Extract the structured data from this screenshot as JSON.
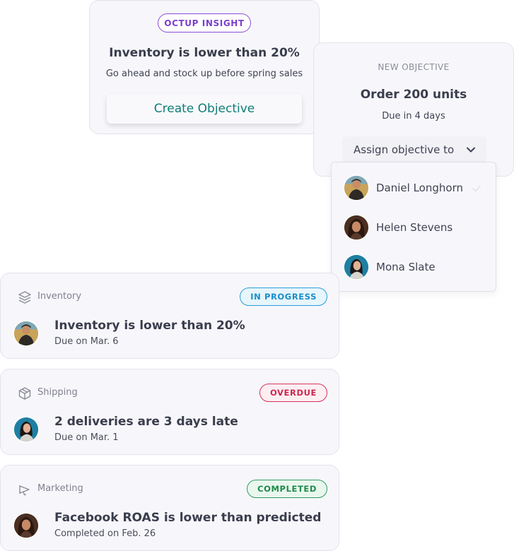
{
  "insight": {
    "badge": "OCTUP INSIGHT",
    "title": "Inventory is lower than 20%",
    "subtitle": "Go ahead and stock up before spring sales",
    "button": "Create Objective"
  },
  "objective": {
    "label": "NEW OBJECTIVE",
    "title": "Order 200 units",
    "due": "Due in 4 days",
    "assign_label": "Assign objective to"
  },
  "assignees": [
    {
      "name": "Daniel Longhorn",
      "selected": true
    },
    {
      "name": "Helen Stevens",
      "selected": false
    },
    {
      "name": "Mona Slate",
      "selected": false
    }
  ],
  "tasks": [
    {
      "category": "Inventory",
      "icon": "layers-icon",
      "status": "IN PROGRESS",
      "title": "Inventory is lower than 20%",
      "sub": "Due on Mar. 6"
    },
    {
      "category": "Shipping",
      "icon": "box-icon",
      "status": "OVERDUE",
      "title": "2 deliveries are 3 days late",
      "sub": "Due on Mar. 1"
    },
    {
      "category": "Marketing",
      "icon": "megaphone-icon",
      "status": "COMPLETED",
      "title": "Facebook ROAS is lower than predicted",
      "sub": "Completed on Feb. 26"
    }
  ],
  "colors": {
    "insight_accent": "#7a3fd0",
    "create_button_text": "#0f7d76",
    "in_progress": "#1b8ec7",
    "overdue": "#c8284f",
    "completed": "#1f8a4c"
  }
}
